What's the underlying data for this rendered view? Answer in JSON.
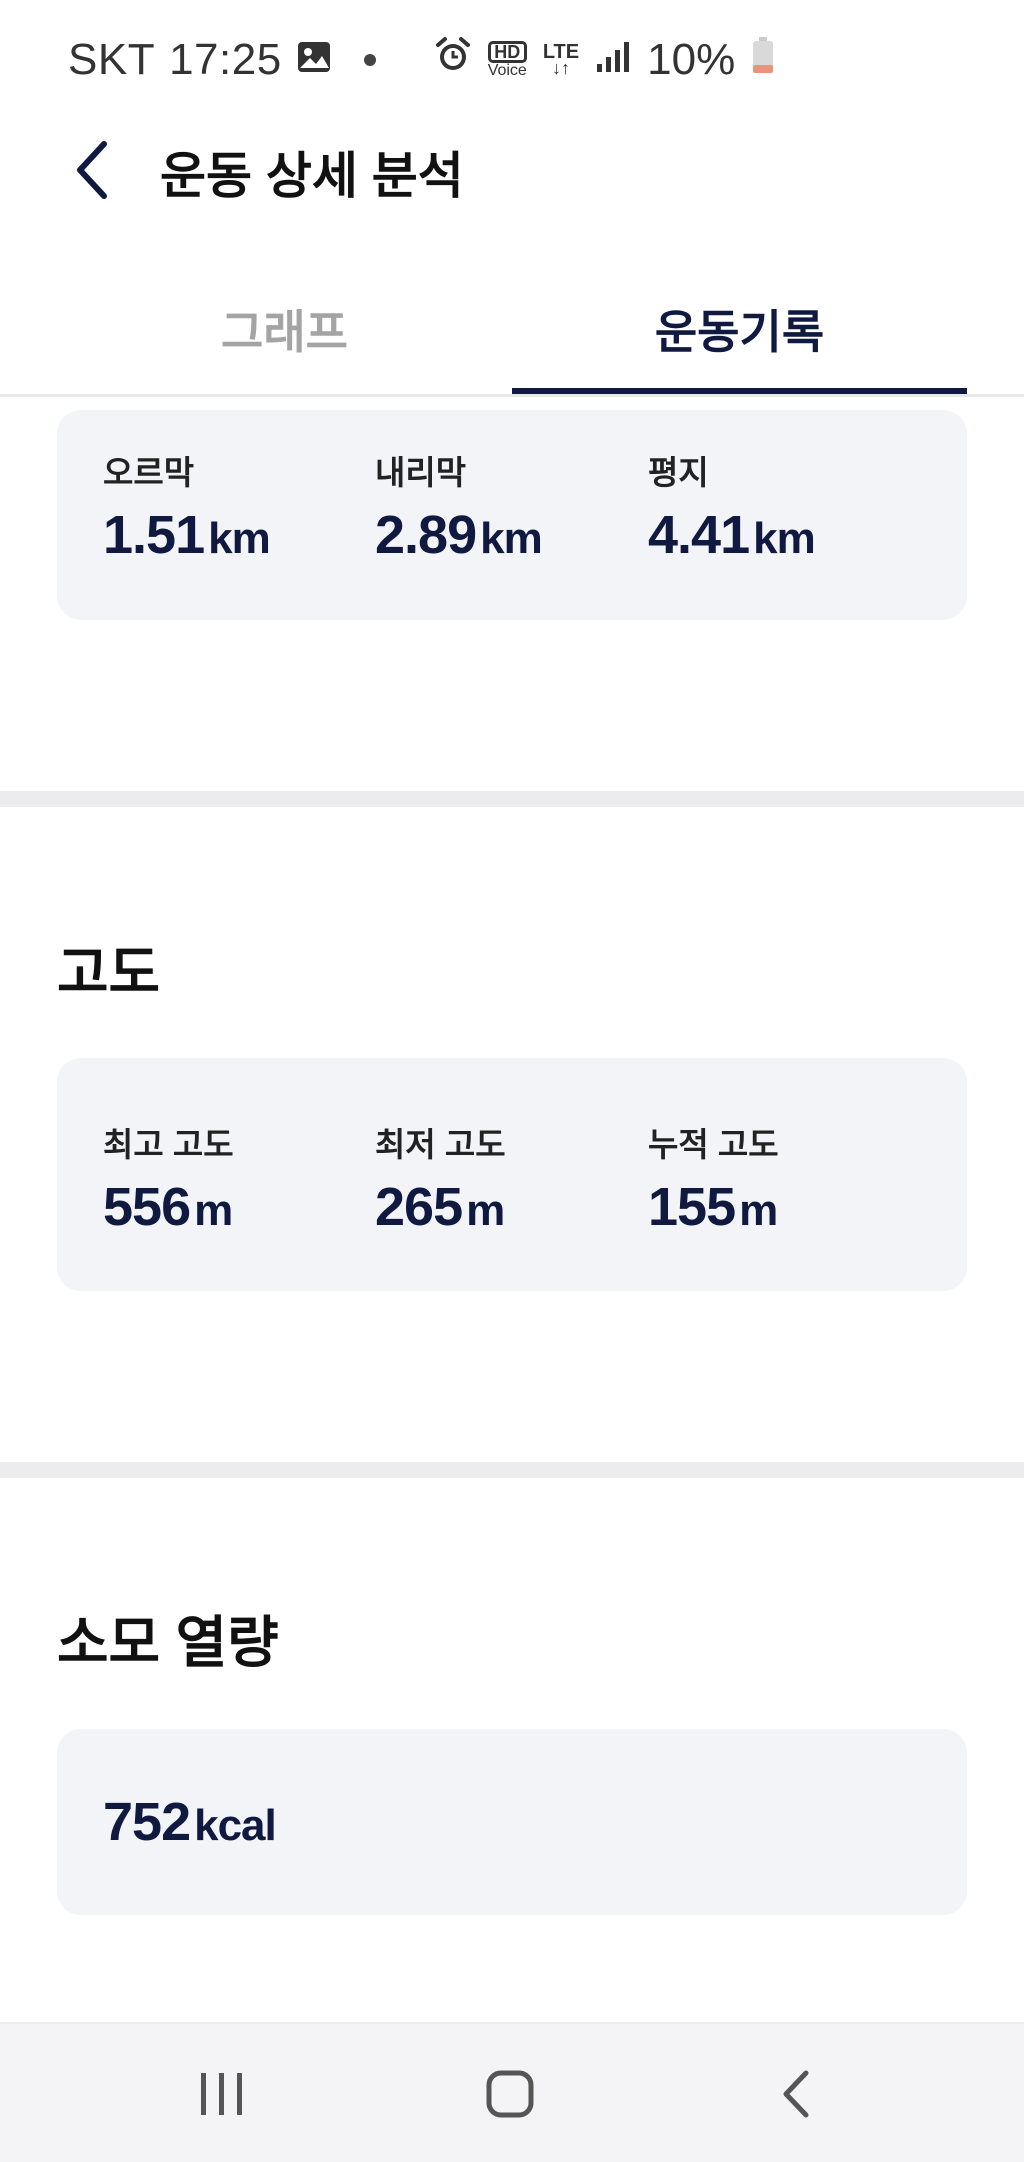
{
  "status_bar": {
    "carrier": "SKT",
    "time": "17:25",
    "hd_label": "HD",
    "voice_label": "Voice",
    "lte_label": "LTE",
    "battery": "10%",
    "accent_low_battery": "#e9947c"
  },
  "header": {
    "title": "운동 상세 분석"
  },
  "tabs": [
    {
      "label": "그래프",
      "selected": false
    },
    {
      "label": "운동기록",
      "selected": true
    }
  ],
  "terrain": {
    "items": [
      {
        "label": "오르막",
        "value": "1.51",
        "unit": "km"
      },
      {
        "label": "내리막",
        "value": "2.89",
        "unit": "km"
      },
      {
        "label": "평지",
        "value": "4.41",
        "unit": "km"
      }
    ]
  },
  "altitude": {
    "title": "고도",
    "items": [
      {
        "label": "최고 고도",
        "value": "556",
        "unit": "m"
      },
      {
        "label": "최저 고도",
        "value": "265",
        "unit": "m"
      },
      {
        "label": "누적 고도",
        "value": "155",
        "unit": "m"
      }
    ]
  },
  "calories": {
    "title": "소모 열량",
    "value": "752",
    "unit": "kcal"
  },
  "colors": {
    "navy": "#10193f",
    "card_bg": "#f3f4f8",
    "inactive_tab": "#a4a4a4"
  }
}
